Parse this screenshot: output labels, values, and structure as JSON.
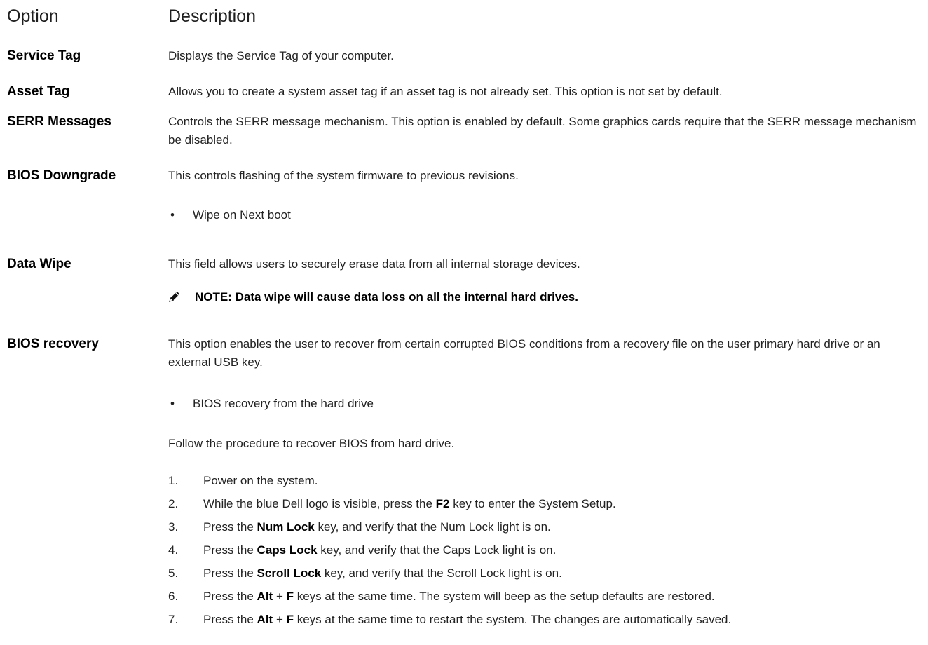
{
  "header": {
    "option": "Option",
    "description": "Description"
  },
  "rows": {
    "service_tag": {
      "option": "Service Tag",
      "desc": "Displays the Service Tag of your computer."
    },
    "asset_tag": {
      "option": "Asset Tag",
      "desc": "Allows you to create a system asset tag if an asset tag is not already set. This option is not set by default."
    },
    "serr": {
      "option": "SERR Messages",
      "desc": "Controls the SERR message mechanism. This option is enabled by default. Some graphics cards require that the SERR message mechanism be disabled."
    },
    "bios_downgrade": {
      "option": "BIOS Downgrade",
      "desc": "This controls flashing of the system firmware to previous revisions.",
      "bullet": "Wipe on Next boot"
    },
    "data_wipe": {
      "option": "Data Wipe",
      "desc": "This field allows users to securely erase data from all internal storage devices.",
      "note": "NOTE: Data wipe will cause data loss on all the internal hard drives."
    },
    "bios_recovery": {
      "option": "BIOS recovery",
      "desc": "This option enables the user to recover from certain corrupted BIOS conditions from a recovery file on the user primary hard drive or an external USB key.",
      "bullet": "BIOS recovery from the hard drive",
      "procedure": "Follow the procedure to recover BIOS from hard drive."
    }
  },
  "steps": {
    "s1": {
      "num": "1.",
      "a": "Power on the system."
    },
    "s2": {
      "num": "2.",
      "a": "While the blue Dell logo is visible, press the ",
      "k1": "F2",
      "b": " key to enter the System Setup."
    },
    "s3": {
      "num": "3.",
      "a": "Press the ",
      "k1": "Num Lock",
      "b": " key, and verify that the Num Lock light is on."
    },
    "s4": {
      "num": "4.",
      "a": "Press the ",
      "k1": "Caps Lock",
      "b": " key, and verify that the Caps Lock light is on."
    },
    "s5": {
      "num": "5.",
      "a": "Press the ",
      "k1": "Scroll Lock",
      "b": " key, and verify that the Scroll Lock light is on."
    },
    "s6": {
      "num": "6.",
      "a": "Press the ",
      "k1": "Alt",
      "plus": " + ",
      "k2": "F",
      "b": " keys at the same time. The system will beep as the setup defaults are restored."
    },
    "s7": {
      "num": "7.",
      "a": "Press the ",
      "k1": "Alt",
      "plus": " + ",
      "k2": "F",
      "b": " keys at the same time to restart the system. The changes are automatically saved."
    }
  },
  "icons": {
    "note": "pencil-note-icon"
  },
  "colors": {
    "text": "#222222",
    "bold": "#000000"
  }
}
